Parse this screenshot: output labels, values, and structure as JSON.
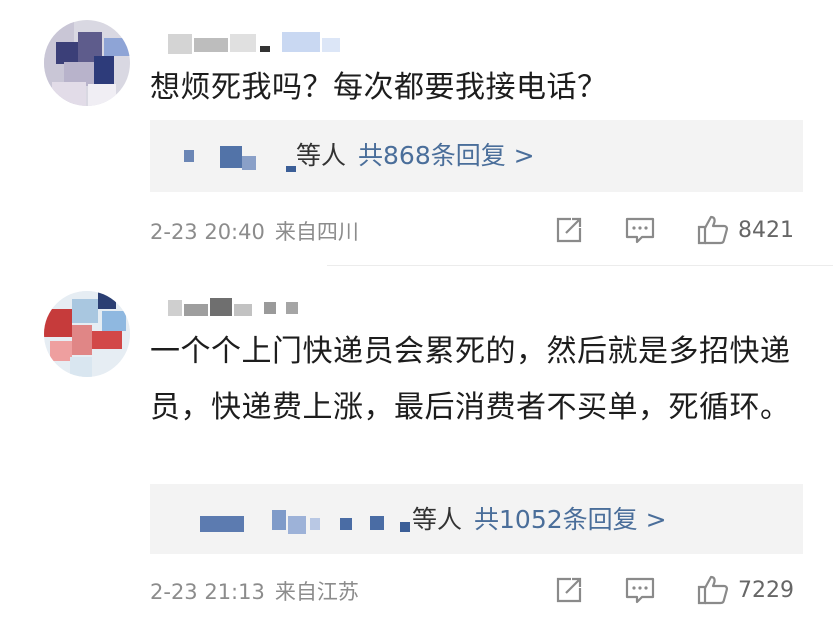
{
  "comments": [
    {
      "text": "想烦死我吗？每次都要我接电话？",
      "reply_summary": {
        "suffix": "等人",
        "link": "共868条回复 >"
      },
      "time": "2-23 20:40",
      "location": "来自四川",
      "likes": "8421",
      "icons": {
        "share": "share-icon",
        "comment": "comment-icon",
        "like": "thumbs-up-icon"
      }
    },
    {
      "text": "一个个上门快递员会累死的，然后就是多招快递员，快递费上涨，最后消费者不买单，死循环。",
      "reply_summary": {
        "suffix": "等人",
        "link": "共1052条回复 >"
      },
      "time": "2-23 21:13",
      "location": "来自江苏",
      "likes": "7229",
      "icons": {
        "share": "share-icon",
        "comment": "comment-icon",
        "like": "thumbs-up-icon"
      }
    }
  ],
  "colors": {
    "link": "#4a6e9a",
    "meta": "#8c8c8c",
    "reply_bg": "#f3f3f3"
  }
}
